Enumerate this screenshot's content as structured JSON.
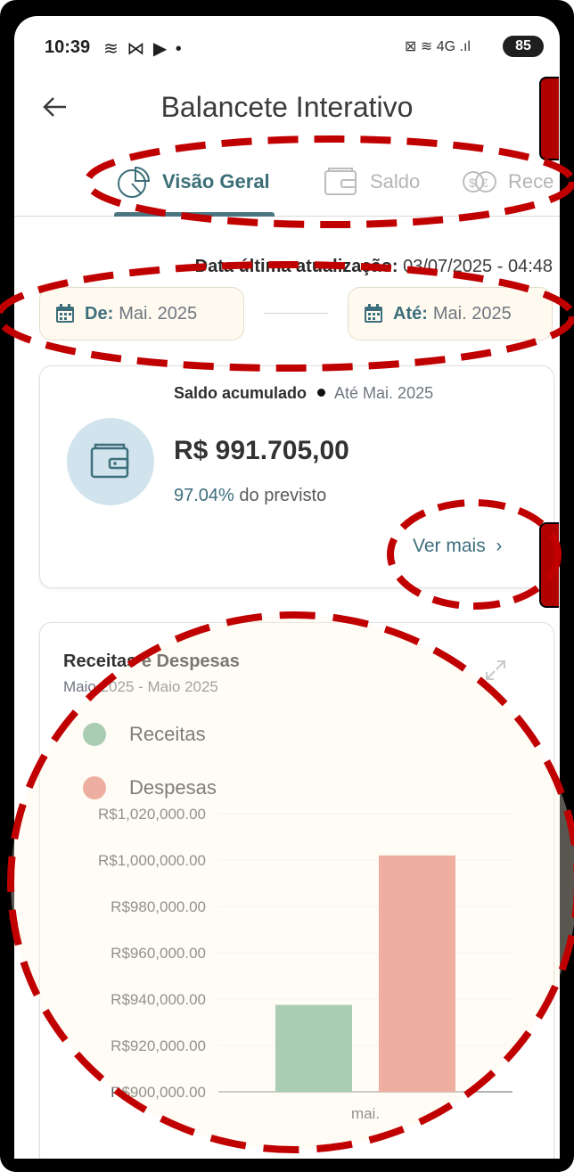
{
  "status_bar": {
    "time": "10:39",
    "left_icons": "≋ ⋈ ▶ •",
    "right_icons": "⊠ ≋ 4G .ıl",
    "battery": "85"
  },
  "appbar": {
    "title": "Balancete Interativo"
  },
  "tabs": [
    {
      "label": "Visão Geral",
      "icon": "pie-chart-icon",
      "active": true
    },
    {
      "label": "Saldo",
      "icon": "wallet-icon",
      "active": false
    },
    {
      "label": "Rece",
      "icon": "currency-exchange-icon",
      "active": false
    }
  ],
  "update": {
    "label": "Data última atualização:",
    "value": "03/07/2025 - 04:48"
  },
  "date_range": {
    "from_label": "De:",
    "from_value": "Mai. 2025",
    "to_label": "Até:",
    "to_value": "Mai. 2025"
  },
  "saldo_card": {
    "label": "Saldo acumulado",
    "sub": "Até Mai. 2025",
    "value": "R$ 991.705,00",
    "pct": "97.04%",
    "pct_suffix": "do previsto",
    "link": "Ver mais",
    "link_icon": "chevron-right-icon"
  },
  "chart_card": {
    "title": "Receitas e Despesas",
    "subtitle": "Maio 2025 - Maio 2025",
    "legend": [
      {
        "label": "Receitas",
        "color": "#7cb59a"
      },
      {
        "label": "Despesas",
        "color": "#e5897d"
      }
    ]
  },
  "colors": {
    "accent": "#3d6e7c",
    "annotation_red": "#c00000",
    "receitas": "#7cb59a",
    "despesas": "#e5897d"
  },
  "chart_data": {
    "type": "bar",
    "title": "Receitas e Despesas",
    "categories": [
      "mai."
    ],
    "series": [
      {
        "name": "Receitas",
        "values": [
          937500
        ]
      },
      {
        "name": "Despesas",
        "values": [
          1002000
        ]
      }
    ],
    "ylim": [
      900000,
      1020000
    ],
    "yticks": [
      "R$900,000.00",
      "R$920,000.00",
      "R$940,000.00",
      "R$960,000.00",
      "R$980,000.00",
      "R$1,000,000.00",
      "R$1,020,000.00"
    ],
    "ytick_values": [
      900000,
      920000,
      940000,
      960000,
      980000,
      1000000,
      1020000
    ],
    "xlabel": "",
    "ylabel": "",
    "grid": true,
    "legend_position": "top-left"
  }
}
